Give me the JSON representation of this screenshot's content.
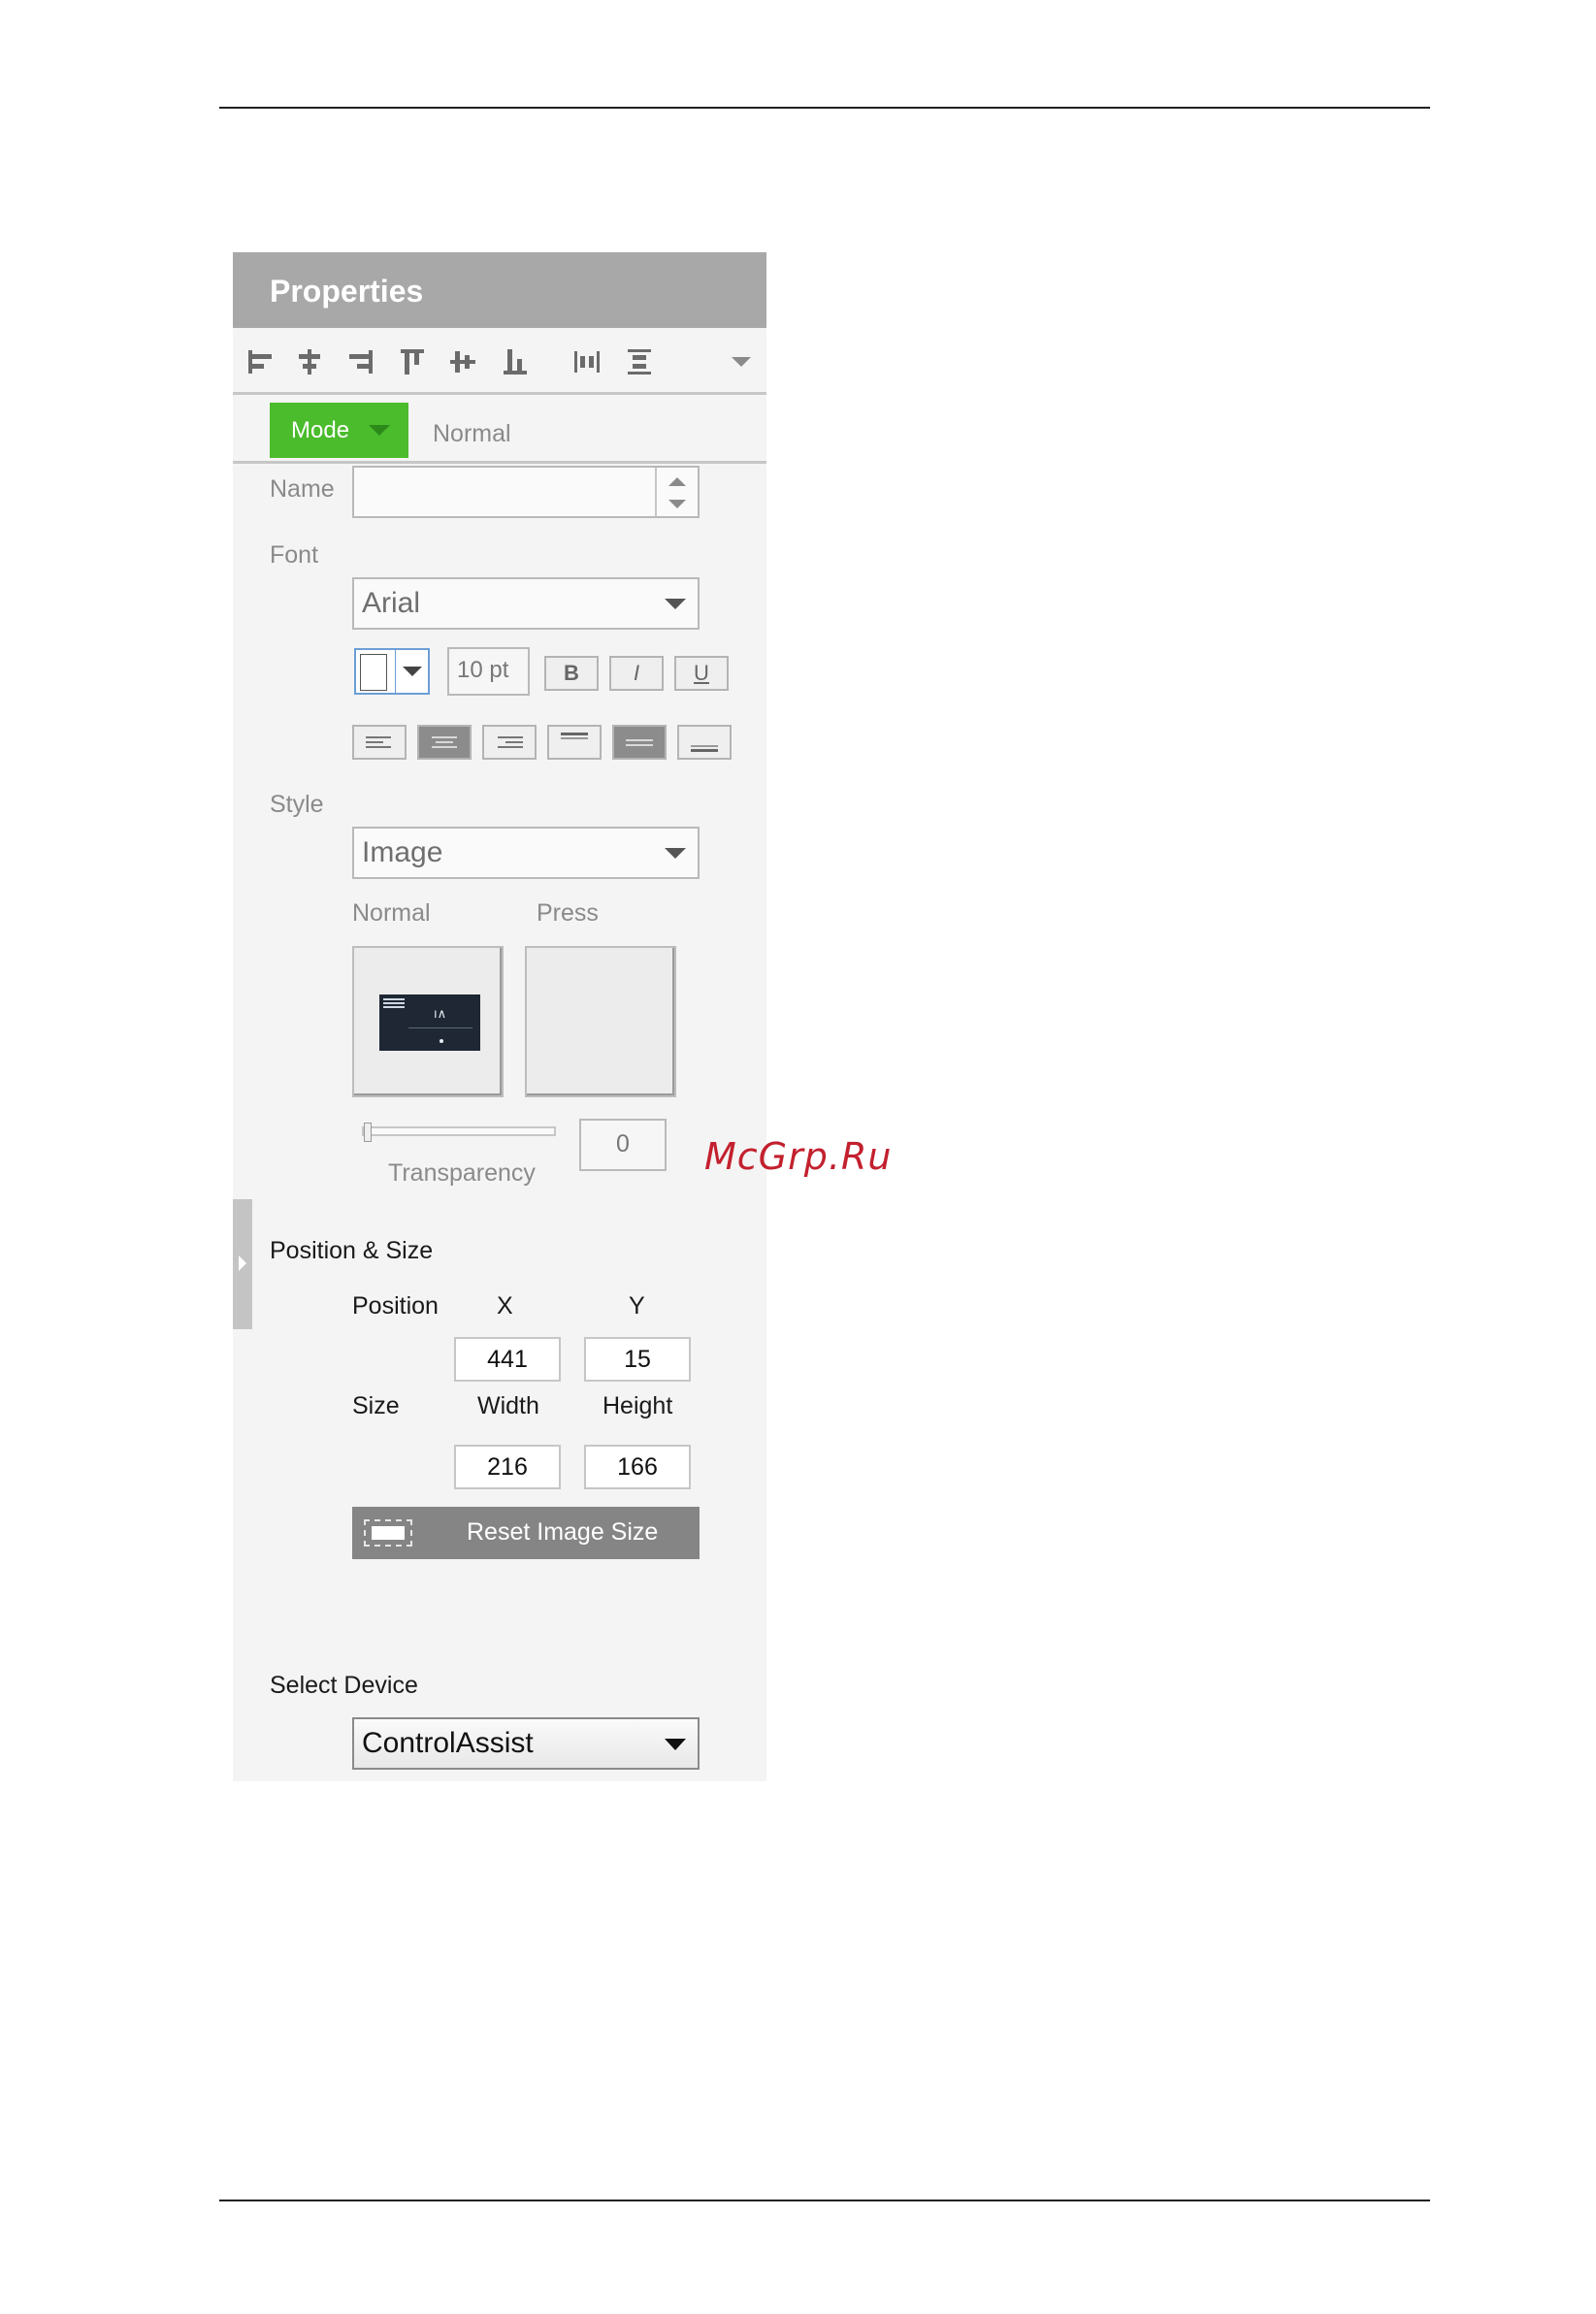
{
  "panel": {
    "title": "Properties",
    "toolbar_icons": [
      "align-left-icon",
      "align-center-h-icon",
      "align-right-icon",
      "align-top-icon",
      "align-middle-v-icon",
      "align-bottom-icon",
      "distribute-horizontal-icon",
      "distribute-vertical-icon"
    ],
    "mode": {
      "label": "Mode",
      "value": "Normal"
    },
    "name": {
      "label": "Name",
      "value": ""
    },
    "font": {
      "label": "Font",
      "family": "Arial",
      "size": "10 pt",
      "bold": "B",
      "italic": "I",
      "underline": "U",
      "align_selected_horizontal": "center",
      "align_selected_vertical": "middle"
    },
    "style": {
      "label": "Style",
      "value": "Image",
      "normal_label": "Normal",
      "press_label": "Press",
      "transparency_label": "Transparency",
      "transparency_value": "0"
    },
    "position_size": {
      "label": "Position & Size",
      "position_label": "Position",
      "x_label": "X",
      "y_label": "Y",
      "x": "441",
      "y": "15",
      "size_label": "Size",
      "width_label": "Width",
      "height_label": "Height",
      "width": "216",
      "height": "166",
      "reset_label": "Reset Image Size"
    },
    "device": {
      "label": "Select Device",
      "value": "ControlAssist"
    }
  },
  "watermark": "McGrp.Ru",
  "colors": {
    "mode_green": "#4bbc2c",
    "header_grey": "#a8a8a8",
    "watermark_red": "#c3202e"
  }
}
